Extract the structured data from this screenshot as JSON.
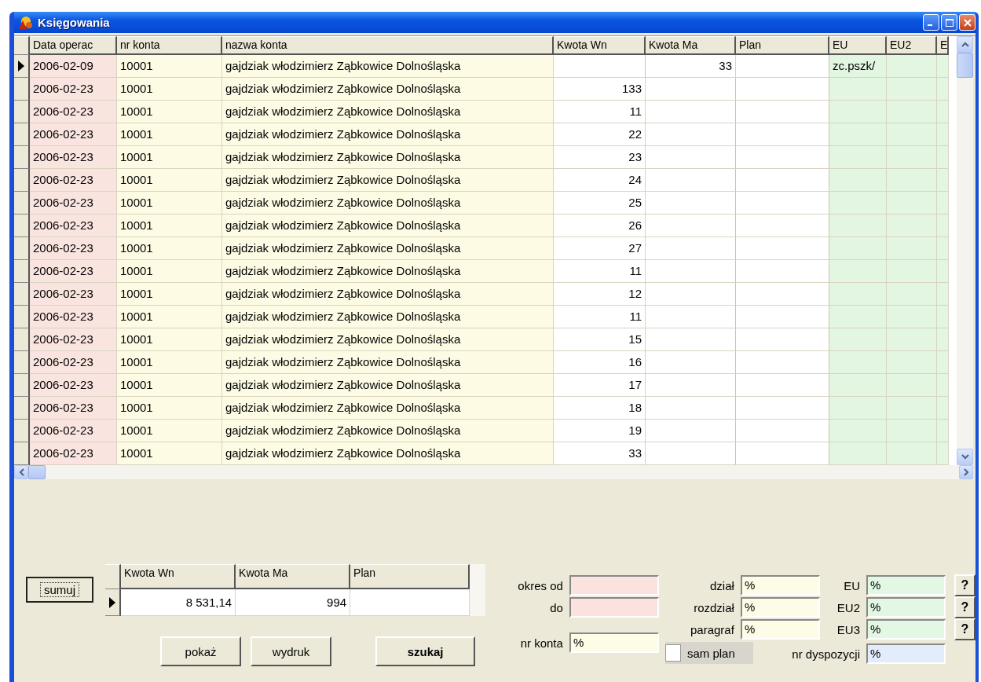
{
  "window": {
    "title": "Księgowania"
  },
  "grid": {
    "columns": [
      {
        "label": "Data operac",
        "kind": "text",
        "color": "#f9e4e0"
      },
      {
        "label": "nr konta",
        "kind": "text",
        "color": "#fdfbe4"
      },
      {
        "label": "nazwa konta",
        "kind": "text",
        "color": "#fdfbe4"
      },
      {
        "label": "Kwota Wn",
        "kind": "number",
        "color": "#ffffff"
      },
      {
        "label": "Kwota Ma",
        "kind": "number",
        "color": "#ffffff"
      },
      {
        "label": "Plan",
        "kind": "number",
        "color": "#ffffff"
      },
      {
        "label": "EU",
        "kind": "text",
        "color": "#e2f6e2"
      },
      {
        "label": "EU2",
        "kind": "text",
        "color": "#e2f6e2"
      },
      {
        "label": "E",
        "kind": "text",
        "color": "#e2f6e2"
      }
    ],
    "rows": [
      {
        "selected": true,
        "data_operac": "2006-02-09",
        "nr_konta": "10001",
        "nazwa_konta": "gajdziak włodzimierz Ząbkowice Dolnośląska",
        "kwota_ma": "33",
        "eu": "zc.pszk/"
      },
      {
        "selected": false,
        "data_operac": "2006-02-23",
        "nr_konta": "10001",
        "nazwa_konta": "gajdziak włodzimierz Ząbkowice Dolnośląska",
        "kwota_wn": "133"
      },
      {
        "selected": false,
        "data_operac": "2006-02-23",
        "nr_konta": "10001",
        "nazwa_konta": "gajdziak włodzimierz Ząbkowice Dolnośląska",
        "kwota_wn": "11"
      },
      {
        "selected": false,
        "data_operac": "2006-02-23",
        "nr_konta": "10001",
        "nazwa_konta": "gajdziak włodzimierz Ząbkowice Dolnośląska",
        "kwota_wn": "22"
      },
      {
        "selected": false,
        "data_operac": "2006-02-23",
        "nr_konta": "10001",
        "nazwa_konta": "gajdziak włodzimierz Ząbkowice Dolnośląska",
        "kwota_wn": "23"
      },
      {
        "selected": false,
        "data_operac": "2006-02-23",
        "nr_konta": "10001",
        "nazwa_konta": "gajdziak włodzimierz Ząbkowice Dolnośląska",
        "kwota_wn": "24"
      },
      {
        "selected": false,
        "data_operac": "2006-02-23",
        "nr_konta": "10001",
        "nazwa_konta": "gajdziak włodzimierz Ząbkowice Dolnośląska",
        "kwota_wn": "25"
      },
      {
        "selected": false,
        "data_operac": "2006-02-23",
        "nr_konta": "10001",
        "nazwa_konta": "gajdziak włodzimierz Ząbkowice Dolnośląska",
        "kwota_wn": "26"
      },
      {
        "selected": false,
        "data_operac": "2006-02-23",
        "nr_konta": "10001",
        "nazwa_konta": "gajdziak włodzimierz Ząbkowice Dolnośląska",
        "kwota_wn": "27"
      },
      {
        "selected": false,
        "data_operac": "2006-02-23",
        "nr_konta": "10001",
        "nazwa_konta": "gajdziak włodzimierz Ząbkowice Dolnośląska",
        "kwota_wn": "11"
      },
      {
        "selected": false,
        "data_operac": "2006-02-23",
        "nr_konta": "10001",
        "nazwa_konta": "gajdziak włodzimierz Ząbkowice Dolnośląska",
        "kwota_wn": "12"
      },
      {
        "selected": false,
        "data_operac": "2006-02-23",
        "nr_konta": "10001",
        "nazwa_konta": "gajdziak włodzimierz Ząbkowice Dolnośląska",
        "kwota_wn": "11"
      },
      {
        "selected": false,
        "data_operac": "2006-02-23",
        "nr_konta": "10001",
        "nazwa_konta": "gajdziak włodzimierz Ząbkowice Dolnośląska",
        "kwota_wn": "15"
      },
      {
        "selected": false,
        "data_operac": "2006-02-23",
        "nr_konta": "10001",
        "nazwa_konta": "gajdziak włodzimierz Ząbkowice Dolnośląska",
        "kwota_wn": "16"
      },
      {
        "selected": false,
        "data_operac": "2006-02-23",
        "nr_konta": "10001",
        "nazwa_konta": "gajdziak włodzimierz Ząbkowice Dolnośląska",
        "kwota_wn": "17"
      },
      {
        "selected": false,
        "data_operac": "2006-02-23",
        "nr_konta": "10001",
        "nazwa_konta": "gajdziak włodzimierz Ząbkowice Dolnośląska",
        "kwota_wn": "18"
      },
      {
        "selected": false,
        "data_operac": "2006-02-23",
        "nr_konta": "10001",
        "nazwa_konta": "gajdziak włodzimierz Ząbkowice Dolnośląska",
        "kwota_wn": "19"
      },
      {
        "selected": false,
        "data_operac": "2006-02-23",
        "nr_konta": "10001",
        "nazwa_konta": "gajdziak włodzimierz Ząbkowice Dolnośląska",
        "kwota_wn": "33"
      }
    ]
  },
  "summary": {
    "button": "sumuj",
    "columns": [
      "Kwota Wn",
      "Kwota Ma",
      "Plan"
    ],
    "row": {
      "selected": true,
      "kwota_wn": "8 531,14",
      "kwota_ma": "994"
    }
  },
  "buttons": [
    {
      "label": "pokaż",
      "kind": "normal"
    },
    {
      "label": "wydruk",
      "kind": "normal"
    },
    {
      "label": "szukaj",
      "kind": "bold"
    }
  ],
  "filters": {
    "okres": [
      {
        "label": "okres od",
        "color": "#fbe2df"
      },
      {
        "label": "do",
        "color": "#fbe2df"
      }
    ],
    "nr_konta": {
      "label": "nr konta",
      "value": "%",
      "color": "#fdfce6"
    },
    "klasyfikacja": [
      {
        "label": "dział",
        "value": "%",
        "color": "#fdfce6"
      },
      {
        "label": "rozdział",
        "value": "%",
        "color": "#fdfce6"
      },
      {
        "label": "paragraf",
        "value": "%",
        "color": "#fdfce6"
      }
    ],
    "eu": [
      {
        "label": "EU",
        "value": "%",
        "color": "#e2f8e4",
        "help": "?"
      },
      {
        "label": "EU2",
        "value": "%",
        "color": "#e2f8e4",
        "help": "?"
      },
      {
        "label": "EU3",
        "value": "%",
        "color": "#e2f8e4",
        "help": "?"
      }
    ],
    "sam_plan": {
      "label": "sam plan",
      "checked": false
    },
    "nr_dyspozycji": {
      "label": "nr dyspozycji",
      "value": "%",
      "color": "#e2ecfb"
    }
  }
}
